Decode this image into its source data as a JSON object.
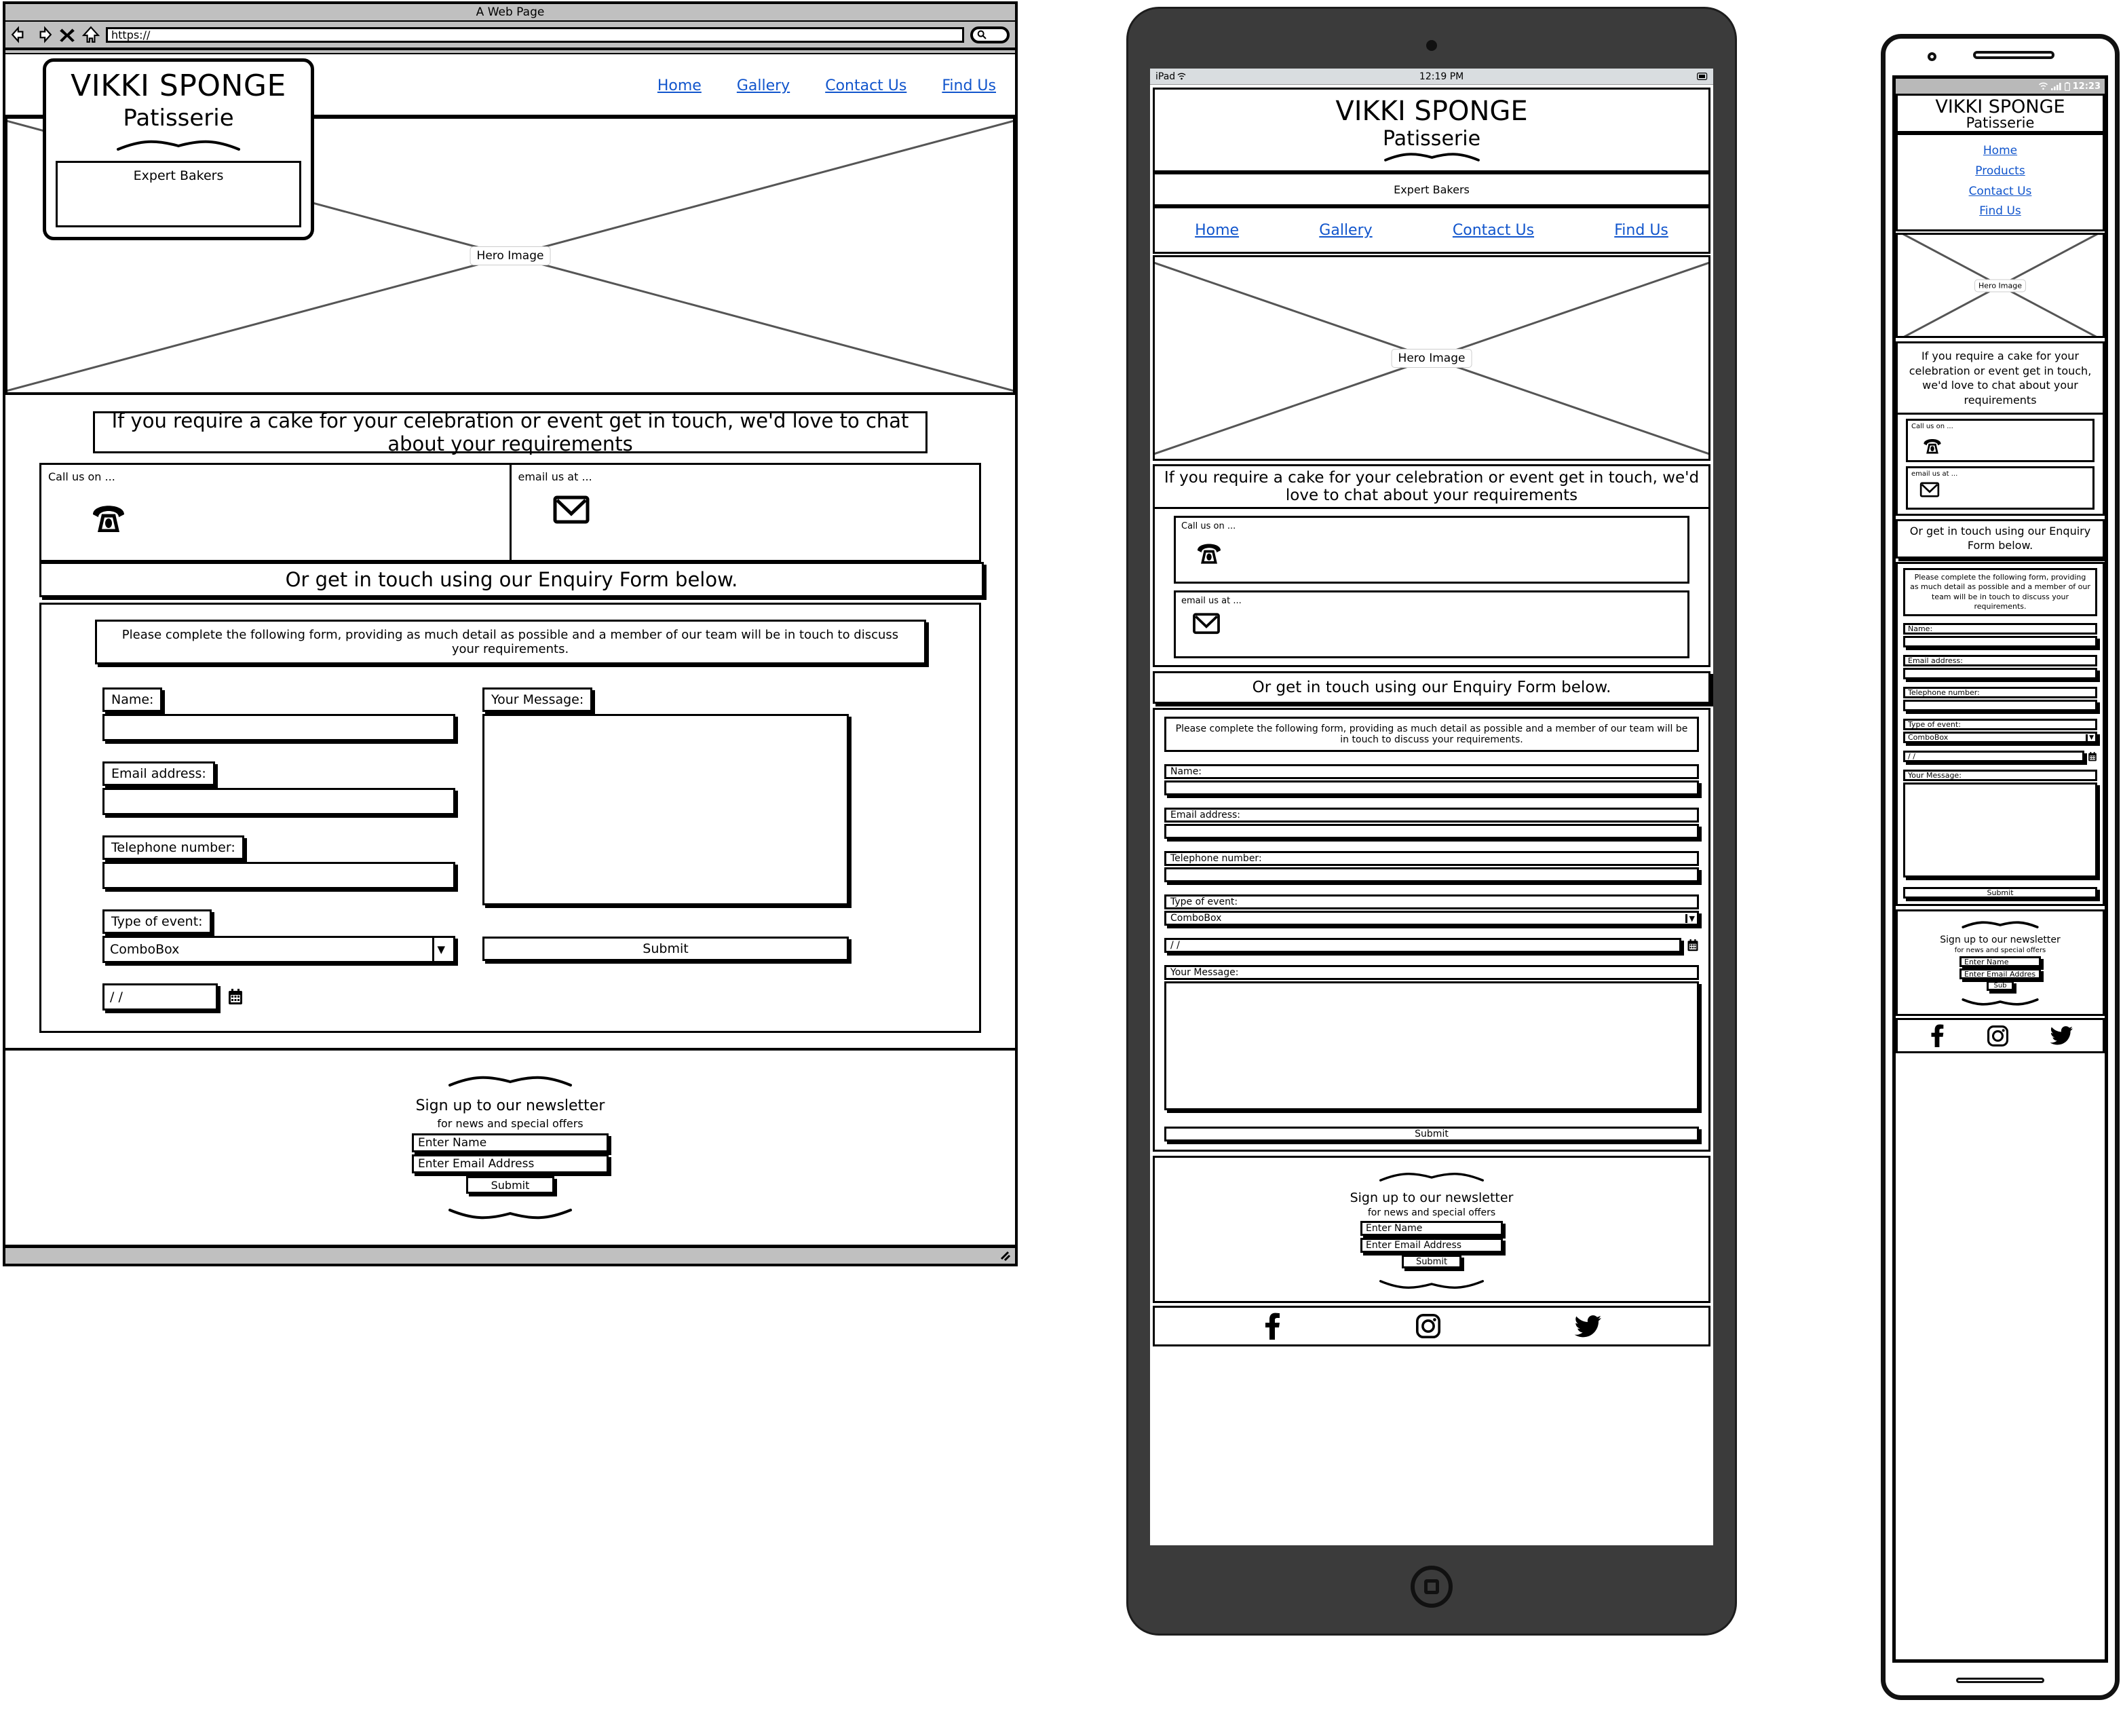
{
  "browser": {
    "title": "A Web Page",
    "url_value": "https://",
    "back_icon": "back-arrow-icon",
    "forward_icon": "forward-arrow-icon",
    "stop_icon": "stop-x-icon",
    "home_icon": "home-icon",
    "search_icon": "search-icon",
    "resize_grip": "resize-grip-icon"
  },
  "brand": {
    "name": "VIKKI SPONGE",
    "subtitle": "Patisserie",
    "tagline": "Expert Bakers"
  },
  "nav": {
    "desktop": [
      "Home",
      "Gallery",
      "Contact Us",
      "Find Us"
    ],
    "tablet": [
      "Home",
      "Gallery",
      "Contact Us",
      "Find Us"
    ],
    "mobile": [
      "Home",
      "Products",
      "Contact Us",
      "Find Us"
    ]
  },
  "hero": {
    "caption": "Hero Image"
  },
  "contact": {
    "intro": "If you require a cake for your celebration or event get in touch, we'd love to chat about your requirements",
    "call_label": "Call us on ...",
    "email_label": "email us at ...",
    "phone_icon": "telephone-icon",
    "envelope_icon": "envelope-icon",
    "enquiry_banner": "Or get in touch using our Enquiry Form below."
  },
  "form": {
    "instructions": "Please complete the following form, providing as much detail as possible and a member of our team will be in touch to discuss your requirements.",
    "name_label": "Name:",
    "name_value": "",
    "email_label": "Email address:",
    "email_value": "",
    "phone_label": "Telephone number:",
    "phone_value": "",
    "event_label": "Type of event:",
    "event_value": "ComboBox",
    "event_arrow": "chevron-down-icon",
    "date_value": "/ /",
    "calendar_icon": "calendar-icon",
    "message_label": "Your Message:",
    "message_value": "",
    "submit_label": "Submit"
  },
  "newsletter": {
    "heading": "Sign up to our newsletter",
    "subheading": "for news and special offers",
    "name_placeholder": "Enter Name",
    "email_placeholder": "Enter Email Address",
    "email_placeholder_mobile": "Enter Email Addres",
    "submit_label": "Submit",
    "submit_label_mobile": "Sub",
    "divider_icon": "swash-divider-icon"
  },
  "footer": {
    "facebook_icon": "facebook-icon",
    "instagram_icon": "instagram-icon",
    "twitter_icon": "twitter-icon"
  },
  "tablet": {
    "device_label": "iPad",
    "wifi_icon": "wifi-icon",
    "time": "12:19 PM",
    "battery_icon": "battery-icon",
    "home_button": "home-button"
  },
  "mobile": {
    "wifi_icon": "wifi-icon",
    "signal_icon": "signal-bars-icon",
    "battery_icon": "battery-icon",
    "time": "12:23",
    "camera": "front-camera",
    "speaker": "earpiece-speaker"
  },
  "colors": {
    "link": "#1155cc",
    "chrome": "#c0c0c0",
    "device": "#3b3b3b"
  }
}
